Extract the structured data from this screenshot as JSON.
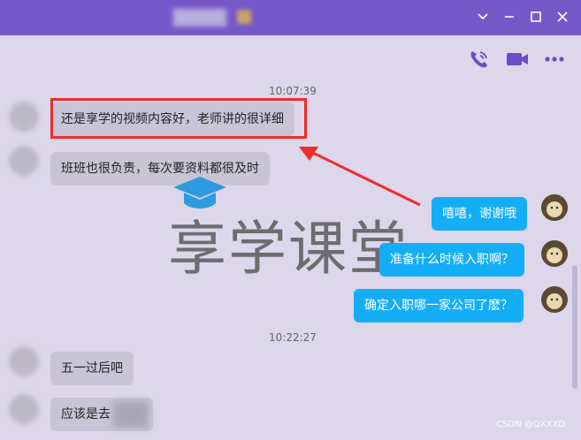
{
  "window": {
    "title_bar_color": "#7659c8",
    "controls": [
      "chevron-down-icon",
      "minimize-icon",
      "maximize-icon",
      "close-icon"
    ]
  },
  "toolbar": {
    "icons": [
      "voice-call-icon",
      "video-call-icon",
      "more-icon"
    ]
  },
  "watermark": {
    "text": "享学课堂"
  },
  "messages": [
    {
      "type": "time",
      "text": "10:07:39"
    },
    {
      "type": "left",
      "text": "还是享学的视频内容好，老师讲的很详细",
      "highlighted": true
    },
    {
      "type": "left",
      "text": "班班也很负责，每次要资料都很及时"
    },
    {
      "type": "right",
      "text": "嘻嘻，谢谢哦"
    },
    {
      "type": "right",
      "text": "准备什么时候入职啊？"
    },
    {
      "type": "right",
      "text": "确定入职哪一家公司了麽？"
    },
    {
      "type": "time",
      "text": "10:22:27"
    },
    {
      "type": "left",
      "text": "五一过后吧"
    },
    {
      "type": "left",
      "text": "应该是去"
    }
  ],
  "footer": {
    "credit": "CSDN @QXXXD"
  },
  "colors": {
    "background": "#dcd7ea",
    "right_bubble": "#14aef6",
    "left_bubble": "#c9c5d6",
    "highlight": "#ee2c2c"
  }
}
